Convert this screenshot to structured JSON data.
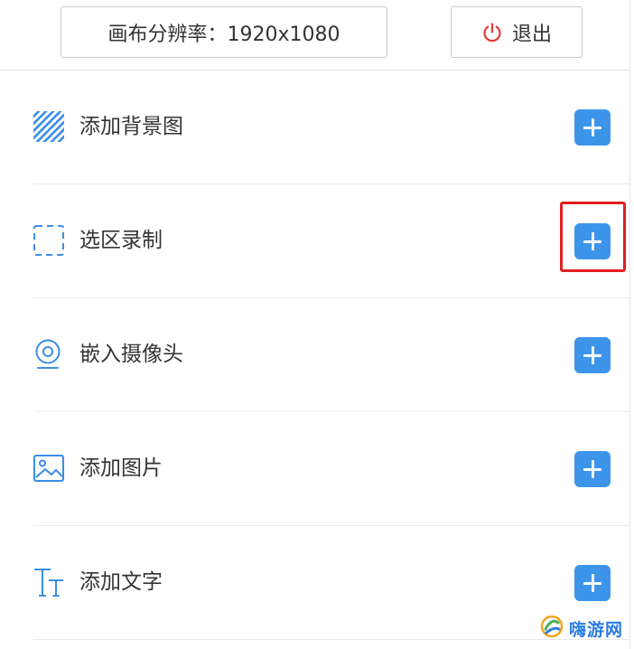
{
  "toolbar": {
    "resolution_label": "画布分辨率：1920x1080",
    "exit_label": "退出"
  },
  "rows": [
    {
      "label": "添加背景图",
      "icon": "background-pattern-icon"
    },
    {
      "label": "选区录制",
      "icon": "region-select-icon"
    },
    {
      "label": "嵌入摄像头",
      "icon": "camera-icon"
    },
    {
      "label": "添加图片",
      "icon": "image-icon"
    },
    {
      "label": "添加文字",
      "icon": "text-icon"
    }
  ],
  "watermark": {
    "text": "嗨游网"
  },
  "colors": {
    "accent_blue": "#3d95ea",
    "icon_blue": "#3a8ee6",
    "exit_red": "#e53935",
    "highlight_red": "#e02020"
  }
}
